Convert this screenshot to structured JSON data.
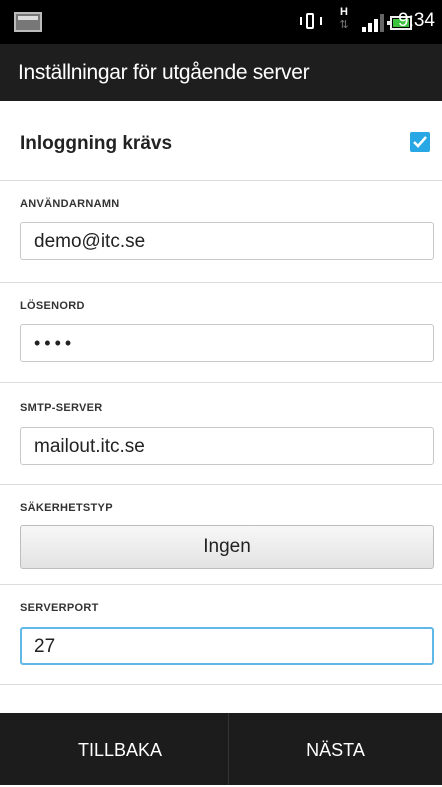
{
  "status_bar": {
    "time": "9:34",
    "network_label": "H"
  },
  "header": {
    "title": "Inställningar för utgående server"
  },
  "login_required": {
    "label": "Inloggning krävs",
    "checked": true
  },
  "username": {
    "label": "ANVÄNDARNAMN",
    "value": "demo@itc.se"
  },
  "password": {
    "label": "LÖSENORD",
    "value": "••••"
  },
  "smtp_server": {
    "label": "SMTP-SERVER",
    "value": "mailout.itc.se"
  },
  "security_type": {
    "label": "SÄKERHETSTYP",
    "value": "Ingen"
  },
  "server_port": {
    "label": "SERVERPORT",
    "value": "27"
  },
  "buttons": {
    "back": "TILLBAKA",
    "next": "NÄSTA"
  },
  "colors": {
    "accent": "#27a7e4",
    "focus_border": "#5fb8e6",
    "battery": "#3cc23c"
  }
}
